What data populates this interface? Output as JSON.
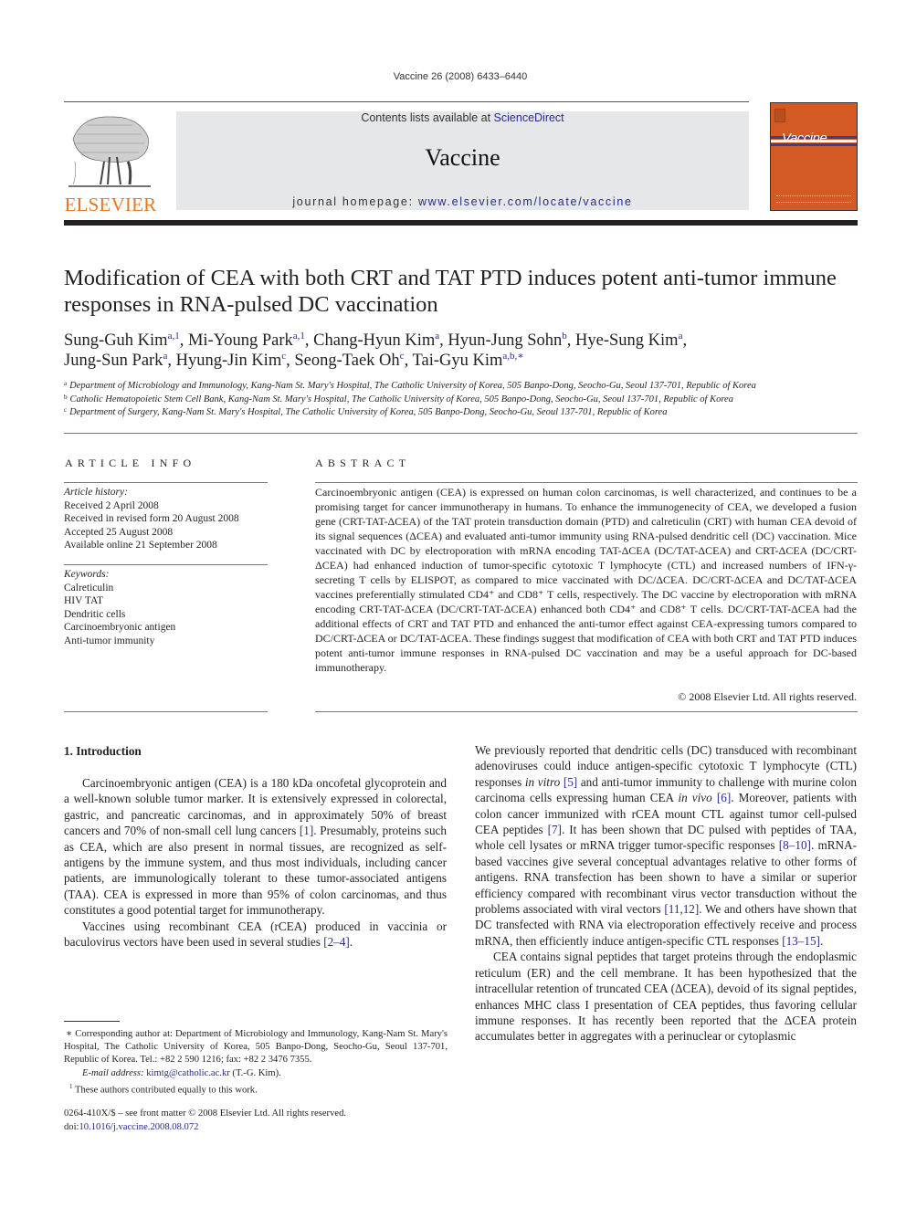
{
  "header": {
    "journal_ref": "Vaccine 26 (2008) 6433–6440",
    "contents_prefix": "Contents lists available at ",
    "contents_link": "ScienceDirect",
    "journal_title": "Vaccine",
    "homepage_prefix": "journal homepage: ",
    "homepage_url": "www.elsevier.com/locate/vaccine",
    "publisher_logo_text": "ELSEVIER",
    "cover_title": "Vaccine",
    "colors": {
      "publisher_orange": "#e87722",
      "cover_orange": "#d35a22",
      "link_blue": "#2a2a8c",
      "banner_gray": "#e6e7e8"
    }
  },
  "article": {
    "title": "Modification of CEA with both CRT and TAT PTD induces potent anti-tumor immune responses in RNA-pulsed DC vaccination",
    "authors": [
      {
        "name": "Sung-Guh Kim",
        "sup": "a,1",
        "sep": ", "
      },
      {
        "name": "Mi-Young Park",
        "sup": "a,1",
        "sep": ", "
      },
      {
        "name": "Chang-Hyun Kim",
        "sup": "a",
        "sep": ", "
      },
      {
        "name": "Hyun-Jung Sohn",
        "sup": "b",
        "sep": ", "
      },
      {
        "name": "Hye-Sung Kim",
        "sup": "a",
        "sep": ", "
      },
      {
        "name": "Jung-Sun Park",
        "sup": "a",
        "sep": ", "
      },
      {
        "name": "Hyung-Jin Kim",
        "sup": "c",
        "sep": ", "
      },
      {
        "name": "Seong-Taek Oh",
        "sup": "c",
        "sep": ", "
      },
      {
        "name": "Tai-Gyu Kim",
        "sup": "a,b,∗",
        "sep": ""
      }
    ],
    "affiliations": [
      {
        "label": "a",
        "text": "Department of Microbiology and Immunology, Kang-Nam St. Mary's Hospital, The Catholic University of Korea, 505 Banpo-Dong, Seocho-Gu, Seoul 137-701, Republic of Korea"
      },
      {
        "label": "b",
        "text": "Catholic Hematopoietic Stem Cell Bank, Kang-Nam St. Mary's Hospital, The Catholic University of Korea, 505 Banpo-Dong, Seocho-Gu, Seoul 137-701, Republic of Korea"
      },
      {
        "label": "c",
        "text": "Department of Surgery, Kang-Nam St. Mary's Hospital, The Catholic University of Korea, 505 Banpo-Dong, Seocho-Gu, Seoul 137-701, Republic of Korea"
      }
    ]
  },
  "article_info": {
    "heading": "ARTICLE INFO",
    "history_label": "Article history:",
    "history": [
      "Received 2 April 2008",
      "Received in revised form 20 August 2008",
      "Accepted 25 August 2008",
      "Available online 21 September 2008"
    ],
    "keywords_label": "Keywords:",
    "keywords": [
      "Calreticulin",
      "HIV TAT",
      "Dendritic cells",
      "Carcinoembryonic antigen",
      "Anti-tumor immunity"
    ]
  },
  "abstract": {
    "heading": "ABSTRACT",
    "text": "Carcinoembryonic antigen (CEA) is expressed on human colon carcinomas, is well characterized, and continues to be a promising target for cancer immunotherapy in humans. To enhance the immunogenecity of CEA, we developed a fusion gene (CRT-TAT-ΔCEA) of the TAT protein transduction domain (PTD) and calreticulin (CRT) with human CEA devoid of its signal sequences (ΔCEA) and evaluated anti-tumor immunity using RNA-pulsed dendritic cell (DC) vaccination. Mice vaccinated with DC by electroporation with mRNA encoding TAT-ΔCEA (DC/TAT-ΔCEA) and CRT-ΔCEA (DC/CRT-ΔCEA) had enhanced induction of tumor-specific cytotoxic T lymphocyte (CTL) and increased numbers of IFN-γ-secreting T cells by ELISPOT, as compared to mice vaccinated with DC/ΔCEA. DC/CRT-ΔCEA and DC/TAT-ΔCEA vaccines preferentially stimulated CD4⁺ and CD8⁺ T cells, respectively. The DC vaccine by electroporation with mRNA encoding CRT-TAT-ΔCEA (DC/CRT-TAT-ΔCEA) enhanced both CD4⁺ and CD8⁺ T cells. DC/CRT-TAT-ΔCEA had the additional effects of CRT and TAT PTD and enhanced the anti-tumor effect against CEA-expressing tumors compared to DC/CRT-ΔCEA or DC/TAT-ΔCEA. These findings suggest that modification of CEA with both CRT and TAT PTD induces potent anti-tumor immune responses in RNA-pulsed DC vaccination and may be a useful approach for DC-based immunotherapy.",
    "copyright": "© 2008 Elsevier Ltd. All rights reserved."
  },
  "body": {
    "section_heading": "1.  Introduction",
    "left_paragraphs": [
      [
        {
          "t": "Carcinoembryonic antigen (CEA) is a 180 kDa oncofetal glycoprotein and a well-known soluble tumor marker. It is extensively expressed in colorectal, gastric, and pancreatic carcinomas, and in approximately 50% of breast cancers and 70% of non-small cell lung cancers "
        },
        {
          "t": "[1]",
          "cite": true
        },
        {
          "t": ". Presumably, proteins such as CEA, which are also present in normal tissues, are recognized as self-antigens by the immune system, and thus most individuals, including cancer patients, are immunologically tolerant to these tumor-associated antigens (TAA). CEA is expressed in more than 95% of colon carcinomas, and thus constitutes a good potential target for immunotherapy."
        }
      ],
      [
        {
          "t": "Vaccines using recombinant CEA (rCEA) produced in vaccinia or baculovirus vectors have been used in several studies "
        },
        {
          "t": "[2–4]",
          "cite": true
        },
        {
          "t": "."
        }
      ]
    ],
    "right_paragraphs": [
      [
        {
          "t": "We previously reported that dendritic cells (DC) transduced with recombinant adenoviruses could induce antigen-specific cytotoxic T lymphocyte (CTL) responses "
        },
        {
          "t": "in vitro",
          "italic": true
        },
        {
          "t": " "
        },
        {
          "t": "[5]",
          "cite": true
        },
        {
          "t": " and anti-tumor immunity to challenge with murine colon carcinoma cells expressing human CEA "
        },
        {
          "t": "in vivo",
          "italic": true
        },
        {
          "t": " "
        },
        {
          "t": "[6]",
          "cite": true
        },
        {
          "t": ". Moreover, patients with colon cancer immunized with rCEA mount CTL against tumor cell-pulsed CEA peptides "
        },
        {
          "t": "[7]",
          "cite": true
        },
        {
          "t": ". It has been shown that DC pulsed with peptides of TAA, whole cell lysates or mRNA trigger tumor-specific responses "
        },
        {
          "t": "[8–10]",
          "cite": true
        },
        {
          "t": ". mRNA-based vaccines give several conceptual advantages relative to other forms of antigens. RNA transfection has been shown to have a similar or superior efficiency compared with recombinant virus vector transduction without the problems associated with viral vectors "
        },
        {
          "t": "[11,12]",
          "cite": true
        },
        {
          "t": ". We and others have shown that DC transfected with RNA via electroporation effectively receive and process mRNA, then efficiently induce antigen-specific CTL responses "
        },
        {
          "t": "[13–15]",
          "cite": true
        },
        {
          "t": "."
        }
      ],
      [
        {
          "t": "CEA contains signal peptides that target proteins through the endoplasmic reticulum (ER) and the cell membrane. It has been hypothesized that the intracellular retention of truncated CEA (ΔCEA), devoid of its signal peptides, enhances MHC class I presentation of CEA peptides, thus favoring cellular immune responses. It has recently been reported that the ΔCEA protein accumulates better in aggregates with a perinuclear or cytoplasmic"
        }
      ]
    ]
  },
  "footnotes": {
    "corresponding_marker": "∗",
    "corresponding": "Corresponding author at: Department of Microbiology and Immunology, Kang-Nam St. Mary's Hospital, The Catholic University of Korea, 505 Banpo-Dong, Seocho-Gu, Seoul 137-701, Republic of Korea. Tel.: +82 2 590 1216; fax: +82 2 3476 7355.",
    "email_label": "E-mail address:",
    "email": "kimtg@catholic.ac.kr",
    "email_suffix": " (T.-G. Kim).",
    "equal_marker": "1",
    "equal_contribution": "These authors contributed equally to this work.",
    "front_matter": "0264-410X/$ – see front matter © 2008 Elsevier Ltd. All rights reserved.",
    "doi_label": "doi:",
    "doi": "10.1016/j.vaccine.2008.08.072"
  }
}
